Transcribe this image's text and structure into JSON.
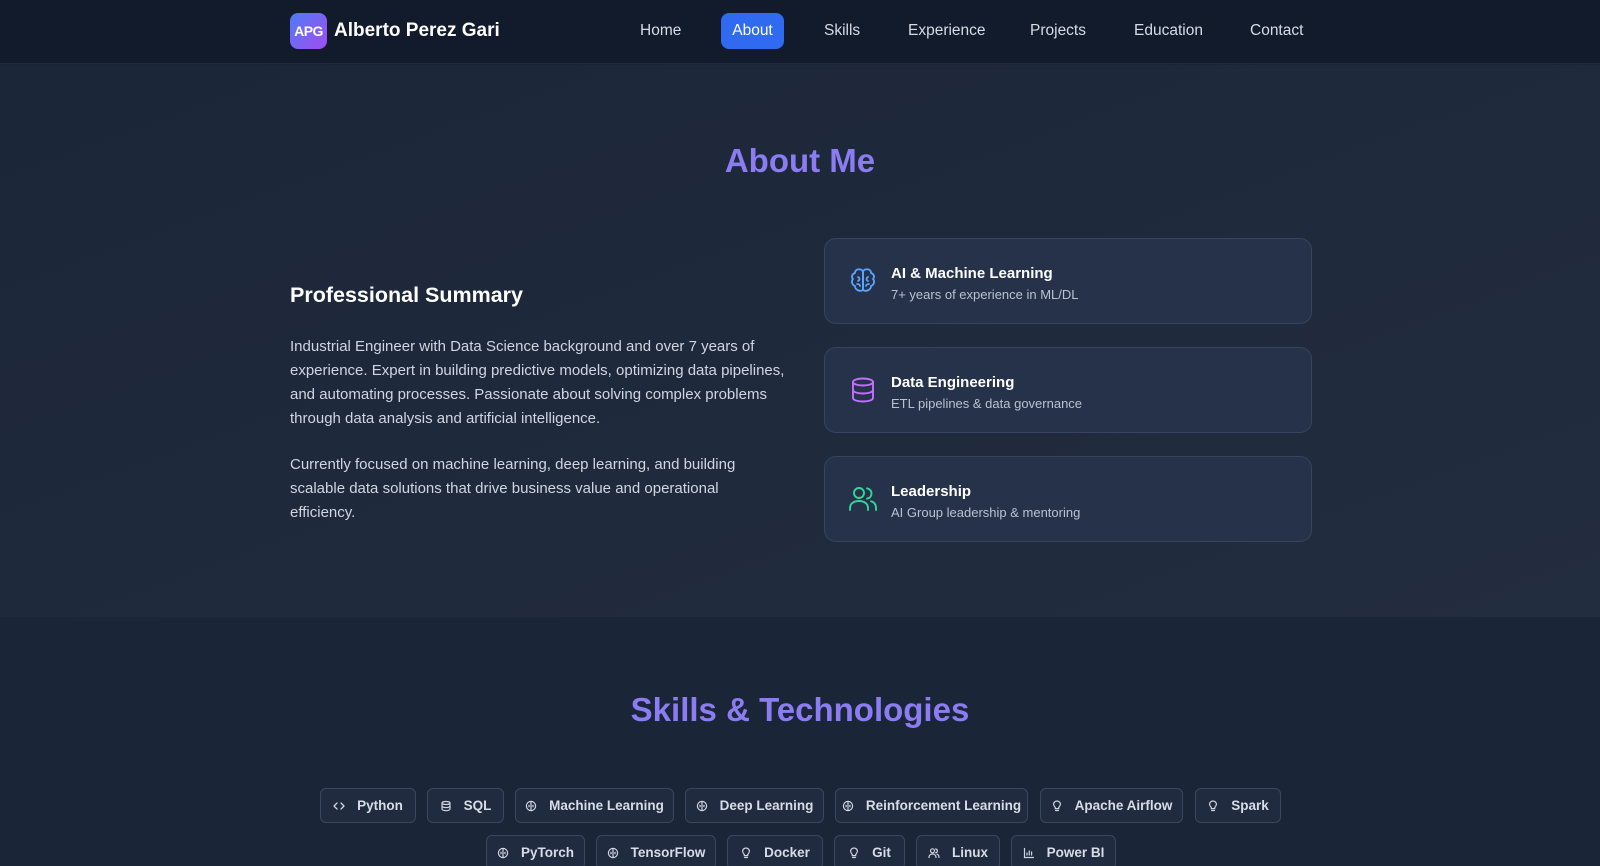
{
  "nav": {
    "logo_text": "APG",
    "brand_name": "Alberto Perez Gari",
    "links": [
      "Home",
      "About",
      "Skills",
      "Experience",
      "Projects",
      "Education",
      "Contact"
    ],
    "active": "About",
    "accent_color": "#2f6af0"
  },
  "about": {
    "title": "About Me",
    "summary_heading": "Professional Summary",
    "paragraphs": [
      "Industrial Engineer with Data Science background and over 7 years of experience. Expert in building predictive models, optimizing data pipelines, and automating processes. Passionate about solving complex problems through data analysis and artificial intelligence.",
      "Currently focused on machine learning, deep learning, and building scalable data solutions that drive business value and operational efficiency."
    ],
    "cards": [
      {
        "icon": "brain-icon",
        "title": "AI & Machine Learning",
        "subtitle": "7+ years of experience in ML/DL",
        "color": "#5aa4ff"
      },
      {
        "icon": "database-icon",
        "title": "Data Engineering",
        "subtitle": "ETL pipelines & data governance",
        "color": "#c470ff"
      },
      {
        "icon": "users-icon",
        "title": "Leadership",
        "subtitle": "AI Group leadership & mentoring",
        "color": "#34d49a"
      }
    ]
  },
  "skills": {
    "title": "Skills & Technologies",
    "chips": [
      {
        "label": "Python",
        "icon": "code-icon"
      },
      {
        "label": "SQL",
        "icon": "database-icon"
      },
      {
        "label": "Machine Learning",
        "icon": "brain-icon"
      },
      {
        "label": "Deep Learning",
        "icon": "brain-icon"
      },
      {
        "label": "Reinforcement Learning",
        "icon": "brain-icon"
      },
      {
        "label": "Apache Airflow",
        "icon": "lightbulb-icon"
      },
      {
        "label": "Spark",
        "icon": "lightbulb-icon"
      },
      {
        "label": "PyTorch",
        "icon": "brain-icon"
      },
      {
        "label": "TensorFlow",
        "icon": "brain-icon"
      },
      {
        "label": "Docker",
        "icon": "lightbulb-icon"
      },
      {
        "label": "Git",
        "icon": "lightbulb-icon"
      },
      {
        "label": "Linux",
        "icon": "users-icon"
      },
      {
        "label": "Power BI",
        "icon": "chart-icon"
      }
    ]
  }
}
